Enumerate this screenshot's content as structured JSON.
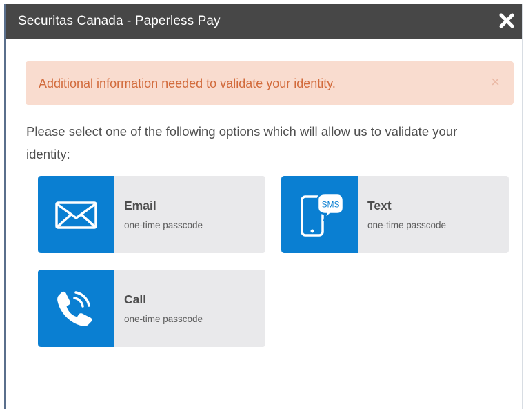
{
  "dialog": {
    "title": "Securitas Canada - Paperless Pay",
    "close_icon": "close-icon"
  },
  "alert": {
    "message": "Additional information needed to validate your identity.",
    "dismiss_label": "×",
    "background_color": "#f9dccf",
    "text_color": "#d26b3c"
  },
  "instructions": "Please select one of the following options which will allow us to validate your identity:",
  "options": [
    {
      "id": "email",
      "title": "Email",
      "subtitle": "one-time passcode",
      "icon": "envelope-icon"
    },
    {
      "id": "text",
      "title": "Text",
      "subtitle": "one-time passcode",
      "icon": "sms-phone-icon",
      "icon_text": "SMS"
    },
    {
      "id": "call",
      "title": "Call",
      "subtitle": "one-time passcode",
      "icon": "phone-call-icon"
    }
  ],
  "colors": {
    "titlebar": "#474747",
    "accent": "#0a7fd2",
    "option_background": "#e9e9eb"
  }
}
